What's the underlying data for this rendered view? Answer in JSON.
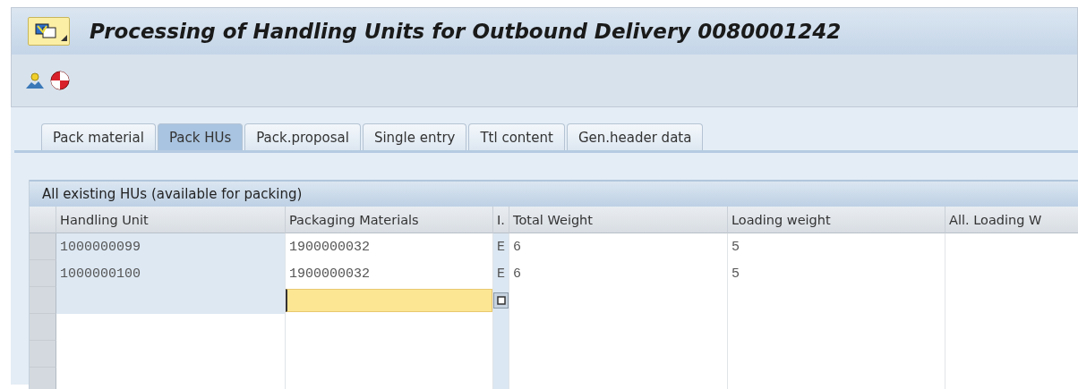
{
  "window": {
    "title": "Processing of Handling Units for Outbound Delivery 0080001242"
  },
  "tabs": [
    {
      "label": "Pack material",
      "selected": false
    },
    {
      "label": "Pack HUs",
      "selected": true
    },
    {
      "label": "Pack.proposal",
      "selected": false
    },
    {
      "label": "Single entry",
      "selected": false
    },
    {
      "label": "Ttl content",
      "selected": false
    },
    {
      "label": "Gen.header data",
      "selected": false
    }
  ],
  "table": {
    "title": "All existing HUs (available for packing)",
    "columns": [
      "Handling Unit",
      "Packaging Materials",
      "I.",
      "Total Weight",
      "Loading weight",
      "All. Loading W"
    ],
    "rows": [
      {
        "kind": "data",
        "cells": [
          "1000000099",
          "1900000032",
          "E",
          "6",
          "5"
        ]
      },
      {
        "kind": "data",
        "cells": [
          "1000000100",
          "1900000032",
          "E",
          "6",
          "5"
        ]
      },
      {
        "kind": "entry",
        "focused": true
      },
      {
        "kind": "empty"
      },
      {
        "kind": "empty"
      },
      {
        "kind": "empty"
      }
    ]
  }
}
